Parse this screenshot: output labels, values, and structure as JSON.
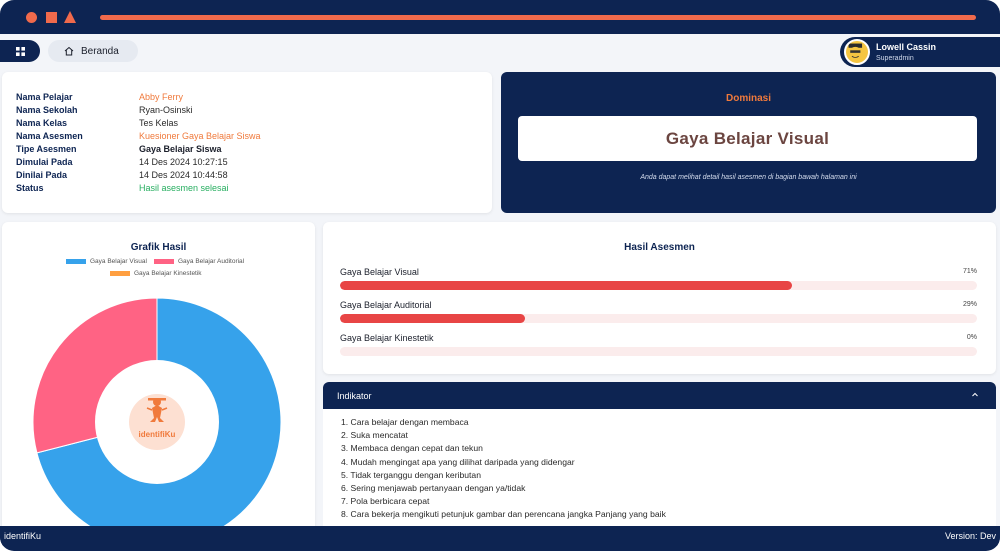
{
  "header": {
    "breadcrumb": "Beranda",
    "user": {
      "name": "Lowell Cassin",
      "role": "Superadmin"
    }
  },
  "info": {
    "rows": [
      {
        "label": "Nama Pelajar",
        "value": "Abby Ferry"
      },
      {
        "label": "Nama Sekolah",
        "value": "Ryan-Osinski"
      },
      {
        "label": "Nama Kelas",
        "value": "Tes Kelas"
      },
      {
        "label": "Nama Asesmen",
        "value": "Kuesioner Gaya Belajar Siswa"
      },
      {
        "label": "Tipe Asesmen",
        "value": "Gaya Belajar Siswa"
      },
      {
        "label": "Dimulai Pada",
        "value": "14 Des 2024 10:27:15"
      },
      {
        "label": "Dinilai Pada",
        "value": "14 Des 2024 10:44:58"
      },
      {
        "label": "Status",
        "value": "Hasil asesmen selesai"
      }
    ]
  },
  "dominasi": {
    "title": "Dominasi",
    "result": "Gaya Belajar Visual",
    "note": "Anda dapat melihat detail hasil asesmen di bagian bawah halaman ini"
  },
  "chart": {
    "title": "Grafik Hasil",
    "logo_text": "identifiKu"
  },
  "chart_data": {
    "type": "pie",
    "title": "Grafik Hasil",
    "categories": [
      "Gaya Belajar Visual",
      "Gaya Belajar Auditorial",
      "Gaya Belajar Kinestetik"
    ],
    "values": [
      71,
      29,
      0
    ],
    "colors": [
      "#36a2eb",
      "#ff6384",
      "#ff9f40"
    ],
    "legend": "top"
  },
  "results": {
    "title": "Hasil Asesmen",
    "items": [
      {
        "label": "Gaya Belajar Visual",
        "pct_text": "71%",
        "value": 71
      },
      {
        "label": "Gaya Belajar Auditorial",
        "pct_text": "29%",
        "value": 29
      },
      {
        "label": "Gaya Belajar Kinestetik",
        "pct_text": "0%",
        "value": 0
      }
    ]
  },
  "indikator": {
    "title": "Indikator",
    "items": [
      "1. Cara belajar dengan membaca",
      "2. Suka mencatat",
      "3. Membaca dengan cepat dan tekun",
      "4. Mudah mengingat apa yang dilihat daripada yang didengar",
      "5. Tidak terganggu dengan keributan",
      "6. Sering menjawab pertanyaan dengan ya/tidak",
      "7. Pola berbicara cepat",
      "8. Cara bekerja mengikuti petunjuk gambar dan perencana jangka Panjang yang baik"
    ]
  },
  "footer": {
    "left": "identifiKu",
    "right": "Version: Dev"
  }
}
